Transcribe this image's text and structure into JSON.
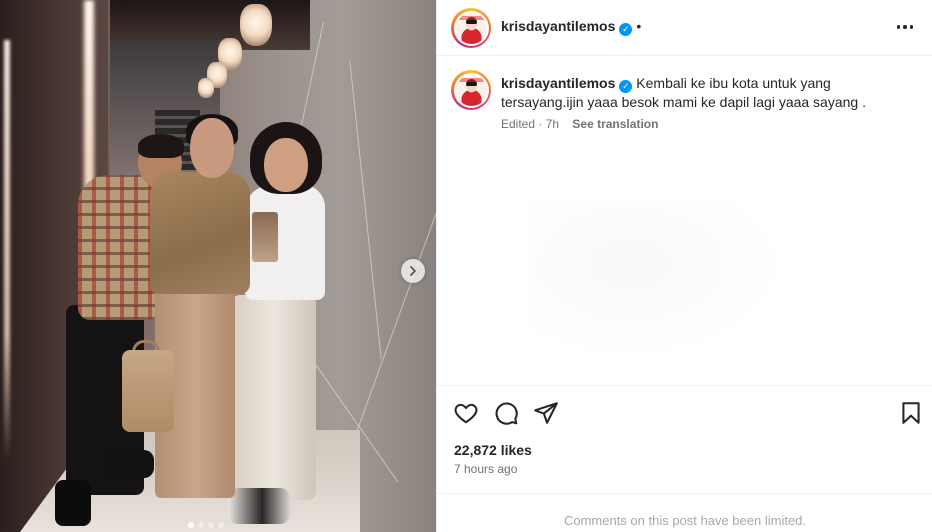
{
  "post": {
    "username": "krisdayantilemos",
    "header_separator": "•",
    "caption_text": "Kembali ke ibu kota untuk yang tersayang.ijin yaaa besok mami ke dapil lagi yaaa sayang .",
    "edited_label": "Edited",
    "meta_separator": " · ",
    "age_short": "7h",
    "see_translation": "See translation",
    "likes": "22,872 likes",
    "posted": "7 hours ago",
    "comments_notice": "Comments on this post have been limited."
  },
  "media": {
    "carousel_dots": 4,
    "active_dot": 0
  },
  "icons": {
    "verified": "verified-badge-icon",
    "more": "more-options-icon",
    "like": "heart-icon",
    "comment": "comment-icon",
    "share": "share-icon",
    "save": "bookmark-icon",
    "next": "chevron-right-icon"
  },
  "colors": {
    "verified": "#0095f6",
    "text": "#262626",
    "secondary": "#737373",
    "muted": "#a8a8a8",
    "border": "#efefef"
  }
}
